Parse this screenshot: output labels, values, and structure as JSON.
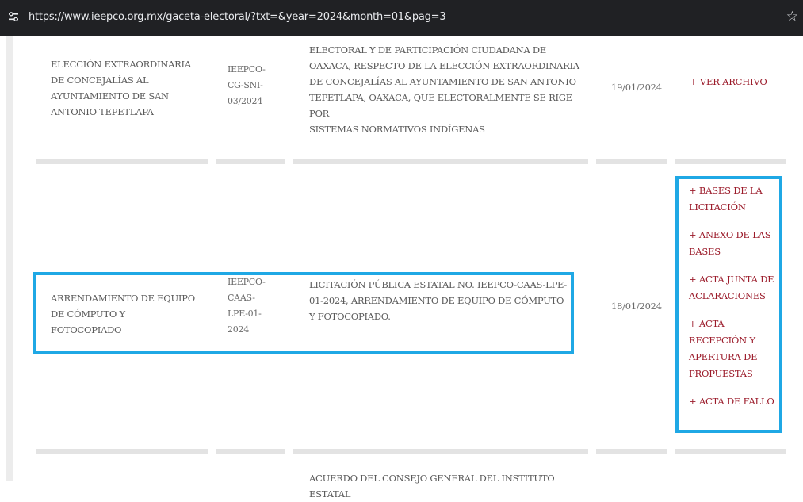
{
  "browser": {
    "url": "https://www.ieepco.org.mx/gaceta-electoral/?txt=&year=2024&month=01&pag=3",
    "tune_icon": "page-info-icon",
    "star_icon": "bookmark-star-icon"
  },
  "rows": [
    {
      "title": "ELECCIÓN EXTRAORDINARIA DE CONCEJALÍAS AL AYUNTAMIENTO DE SAN ANTONIO TEPETLAPA",
      "code_lines": [
        "IEEPCO-",
        "CG-SNI-",
        "03/2024"
      ],
      "description_lines": [
        "ELECTORAL Y DE PARTICIPACIÓN CIUDADANA DE",
        "OAXACA, RESPECTO DE LA ELECCIÓN EXTRAORDINARIA",
        "DE CONCEJALÍAS AL AYUNTAMIENTO DE SAN ANTONIO",
        "TEPETLAPA, OAXACA, QUE ELECTORALMENTE SE RIGE POR",
        "SISTEMAS NORMATIVOS INDÍGENAS"
      ],
      "date": "19/01/2024",
      "actions": [
        "+ VER ARCHIVO"
      ]
    },
    {
      "title": "ARRENDAMIENTO DE EQUIPO DE CÓMPUTO Y FOTOCOPIADO",
      "code_lines": [
        "IEEPCO-",
        "CAAS-",
        "LPE-01-",
        "2024"
      ],
      "description": "LICITACIÓN PÚBLICA ESTATAL No. IEEPCO-CAAS-LPE-01-2024, ARRENDAMIENTO DE EQUIPO DE CÓMPUTO Y FOTOCOPIADO.",
      "date": "18/01/2024",
      "actions": [
        "+ BASES DE LA LICITACIÓN",
        "+ ANEXO DE LAS BASES",
        "+ ACTA JUNTA DE ACLARACIONES",
        "+ ACTA RECEPCIÓN Y APERTURA DE PROPUESTAS",
        "+ ACTA DE FALLO"
      ]
    },
    {
      "description_top": "ACUERDO DEL CONSEJO GENERAL DEL INSTITUTO ESTATAL"
    }
  ],
  "colors": {
    "link": "#9b1b2a",
    "highlight": "#1fa8e5",
    "text": "#5a5a5a",
    "divider": "#e3e3e3"
  }
}
